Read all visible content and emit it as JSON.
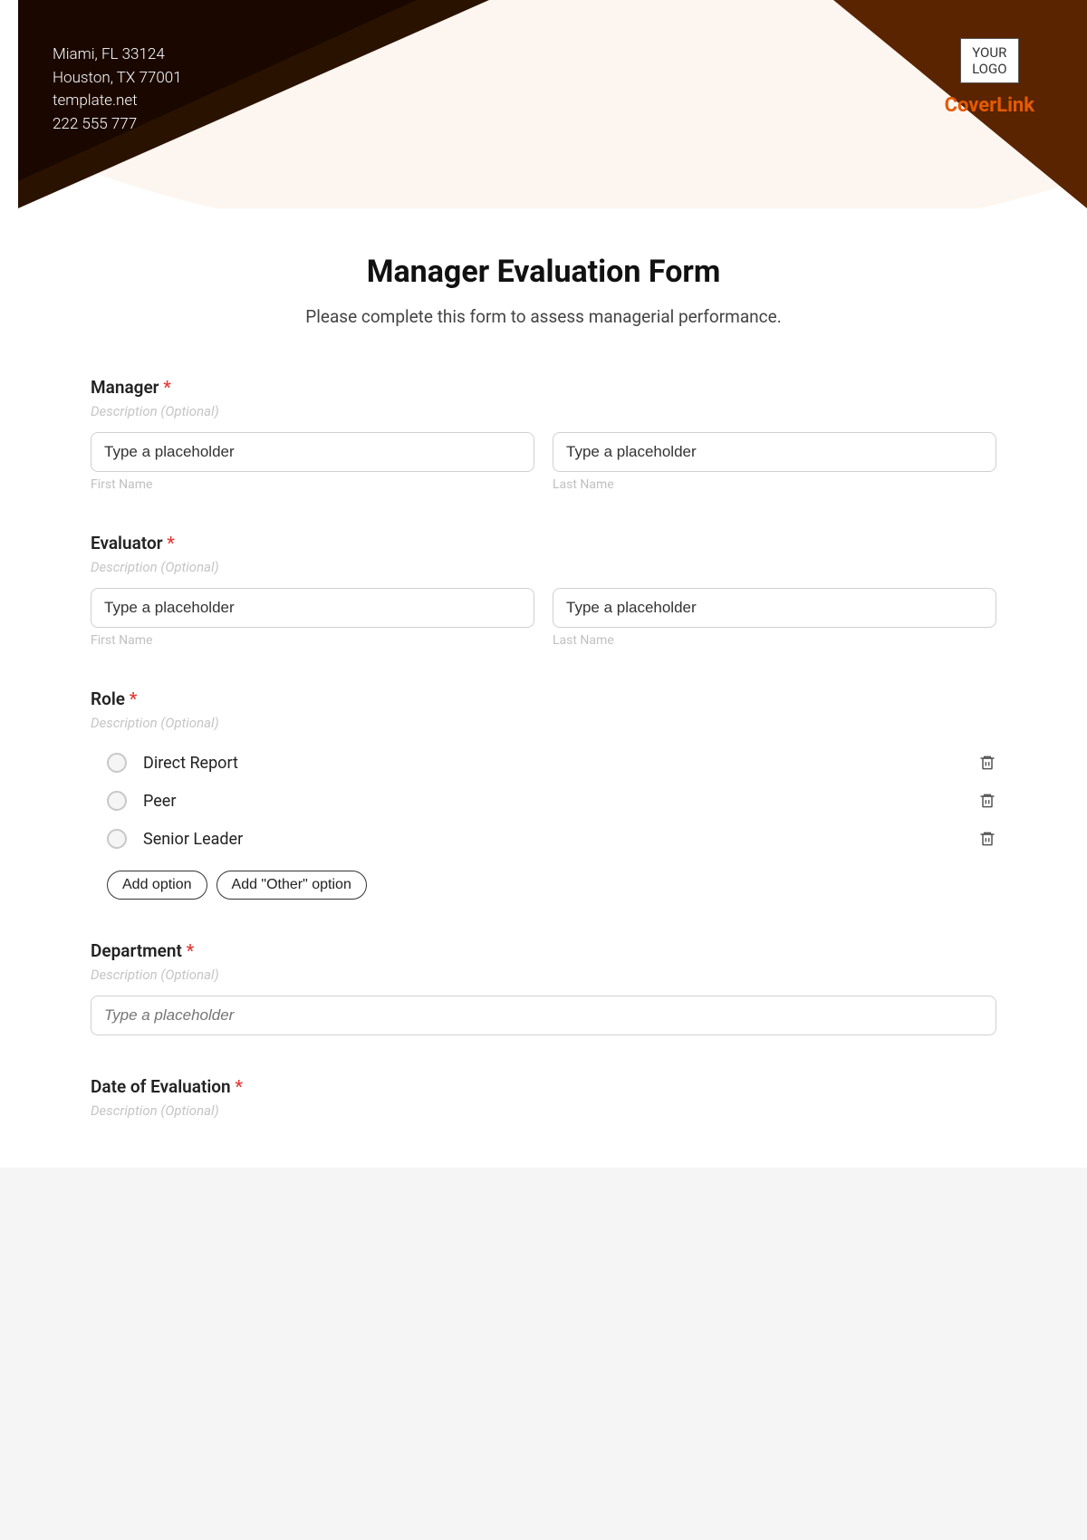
{
  "header": {
    "contact_lines": [
      "Miami, FL 33124",
      "Houston, TX 77001",
      "template.net",
      "222 555 777"
    ],
    "logo_text": "YOUR\nLOGO",
    "brand": "CoverLink"
  },
  "form": {
    "title": "Manager Evaluation Form",
    "subtitle": "Please complete this form to assess managerial performance.",
    "desc_placeholder": "Description (Optional)",
    "input_placeholder": "Type a placeholder",
    "first_name": "First Name",
    "last_name": "Last Name",
    "required_mark": "*",
    "sections": {
      "manager": {
        "label": "Manager"
      },
      "evaluator": {
        "label": "Evaluator"
      },
      "role": {
        "label": "Role",
        "options": [
          "Direct Report",
          "Peer",
          "Senior Leader"
        ],
        "add_option": "Add option",
        "add_other": "Add \"Other\" option"
      },
      "department": {
        "label": "Department"
      },
      "date": {
        "label": "Date of Evaluation"
      }
    }
  }
}
